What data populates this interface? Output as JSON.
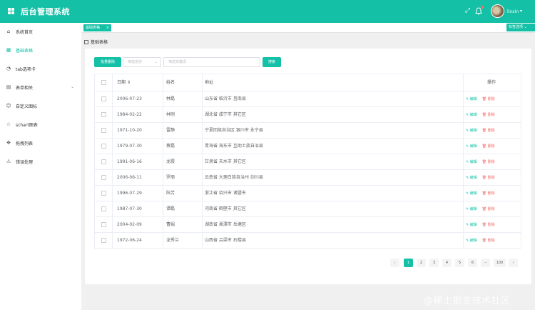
{
  "header": {
    "title": "后台管理系统",
    "username": "linxin",
    "caret": "▾",
    "menu_icon": "grid-icon",
    "fullscreen_icon": "fullscreen-icon",
    "bell_icon": "bell-icon",
    "accent": "#14c0a6"
  },
  "sidebar": {
    "items": [
      {
        "label": "系统首页",
        "icon": "home-icon"
      },
      {
        "label": "基础表格",
        "icon": "table-icon"
      },
      {
        "label": "tab选项卡",
        "icon": "tab-icon"
      },
      {
        "label": "表单相关",
        "icon": "form-icon"
      },
      {
        "label": "自定义图标",
        "icon": "emoji-icon"
      },
      {
        "label": "schart图表",
        "icon": "star-icon"
      },
      {
        "label": "拖拽列表",
        "icon": "drag-icon"
      },
      {
        "label": "错误处理",
        "icon": "warning-icon"
      }
    ],
    "expand_arrow": "⌄"
  },
  "tags": {
    "active_tag": "基础表格",
    "close": "×",
    "options": "标签选项 ⌄"
  },
  "breadcrumb": "基础表格",
  "toolbar": {
    "batch_delete": "批量删除",
    "address_select": "筛选省份",
    "keyword_placeholder": "筛选关键词",
    "search": "搜索",
    "select_caret": "⌄"
  },
  "table": {
    "headers": {
      "date": "日期",
      "sort": "⇕",
      "name": "姓名",
      "address": "地址",
      "ops": "操作"
    },
    "edit_label": "✎ 编辑",
    "delete_label": "🗑 删除",
    "rows": [
      {
        "date": "2006-07-23",
        "name": "林磊",
        "address": "山东省 临沂市 莒南县"
      },
      {
        "date": "1984-02-22",
        "name": "林刚",
        "address": "湖北省 咸宁市 其它区"
      },
      {
        "date": "1971-10-20",
        "name": "雷静",
        "address": "宁夏回族自治区 银川市 永宁县"
      },
      {
        "date": "1979-07-30",
        "name": "蔡磊",
        "address": "青海省 海东市 互助土族自治县"
      },
      {
        "date": "1991-06-16",
        "name": "龙霞",
        "address": "甘肃省 天水市 其它区"
      },
      {
        "date": "2006-06-11",
        "name": "罗丽",
        "address": "云南省 大理白族自治州 剑川县"
      },
      {
        "date": "1996-07-29",
        "name": "陆芳",
        "address": "浙江省 绍兴市 诸暨市"
      },
      {
        "date": "1987-07-30",
        "name": "谭磊",
        "address": "河南省 鹤壁市 其它区"
      },
      {
        "date": "2004-02-09",
        "name": "曹娟",
        "address": "湖南省 湘潭市 岳塘区"
      },
      {
        "date": "1972-06-24",
        "name": "龙秀兰",
        "address": "山西省 吕梁市 石楼县"
      }
    ]
  },
  "pagination": {
    "prev": "‹",
    "next": "›",
    "pages": [
      "1",
      "2",
      "3",
      "4",
      "5",
      "6",
      "···",
      "100"
    ],
    "current": "1"
  },
  "watermark": "@稀土掘金技术社区"
}
